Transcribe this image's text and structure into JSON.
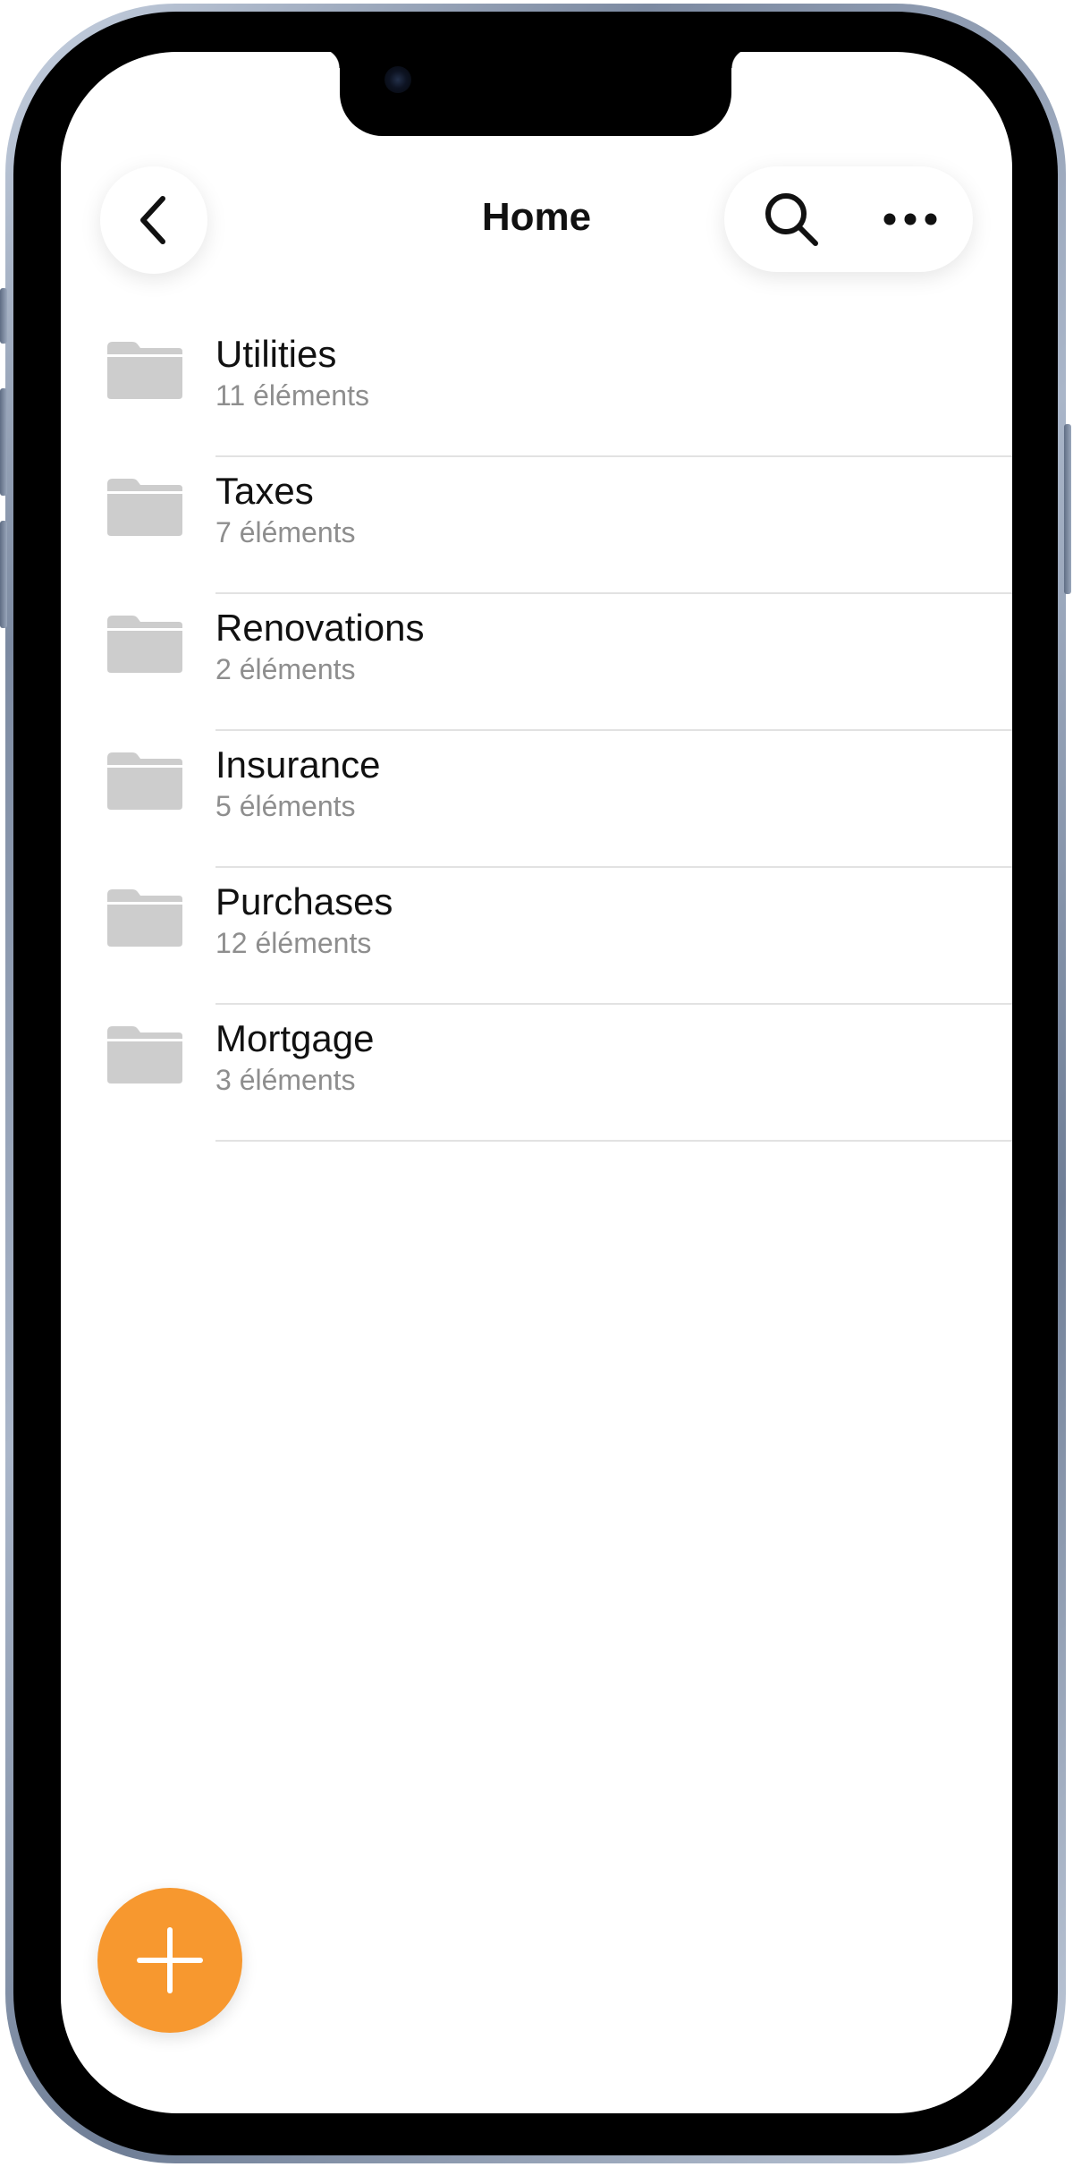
{
  "header": {
    "title": "Home",
    "back_icon": "chevron-left-icon",
    "search_icon": "search-icon",
    "more_icon": "ellipsis-icon"
  },
  "folders": [
    {
      "name": "Utilities",
      "count": "11 éléments"
    },
    {
      "name": "Taxes",
      "count": "7 éléments"
    },
    {
      "name": "Renovations",
      "count": "2 éléments"
    },
    {
      "name": "Insurance",
      "count": "5 éléments"
    },
    {
      "name": "Purchases",
      "count": "12 éléments"
    },
    {
      "name": "Mortgage",
      "count": "3 éléments"
    }
  ],
  "fab": {
    "icon": "plus-icon",
    "color": "#F7982F"
  },
  "colors": {
    "folder_icon": "#CDCDCD",
    "title_text": "#111111",
    "subtitle_text": "#8E8E8E",
    "divider": "#E2E2E2"
  }
}
